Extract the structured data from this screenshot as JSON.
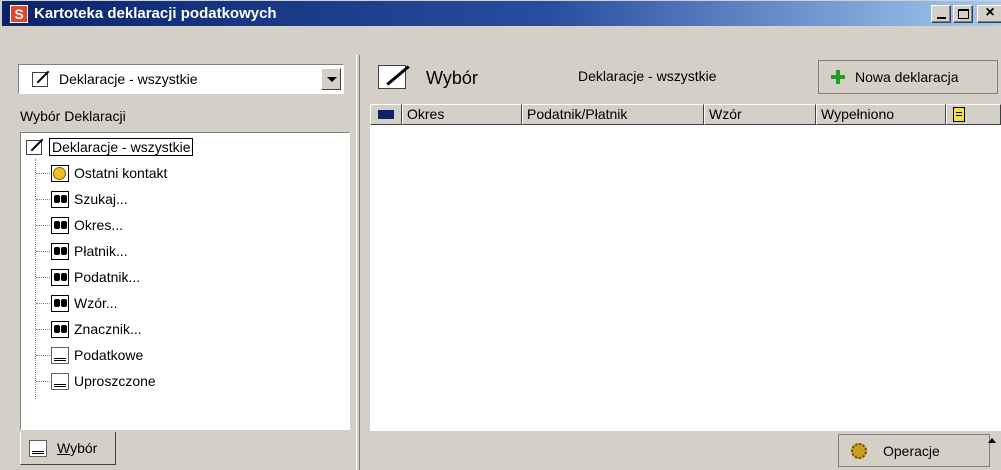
{
  "window": {
    "title": "Kartoteka deklaracji podatkowych",
    "logo_letter": "S"
  },
  "left_panel": {
    "combo_value": "Deklaracje - wszystkie",
    "section_label": "Wybór Deklaracji",
    "tree": {
      "root": "Deklaracje - wszystkie",
      "items": [
        {
          "label": "Ostatni kontakt",
          "icon": "clock-icon"
        },
        {
          "label": "Szukaj...",
          "icon": "binoculars-icon"
        },
        {
          "label": "Okres...",
          "icon": "binoculars-icon"
        },
        {
          "label": "Płatnik...",
          "icon": "binoculars-icon"
        },
        {
          "label": "Podatnik...",
          "icon": "binoculars-icon"
        },
        {
          "label": "Wzór...",
          "icon": "binoculars-icon"
        },
        {
          "label": "Znacznik...",
          "icon": "binoculars-icon"
        },
        {
          "label": "Podatkowe",
          "icon": "document-icon"
        },
        {
          "label": "Uproszczone",
          "icon": "document-icon"
        }
      ]
    },
    "tab_label": "Wybór"
  },
  "right_panel": {
    "wybor_label": "Wybór",
    "view_title": "Deklaracje - wszystkie",
    "new_button_label": "Nowa deklaracja",
    "columns": [
      "Okres",
      "Podatnik/Płatnik",
      "Wzór",
      "Wypełniono"
    ],
    "operations_label": "Operacje"
  },
  "colors": {
    "title_bar": "#0a246a",
    "plus_accent": "#1e9e1e",
    "logo": "#e4462a"
  }
}
